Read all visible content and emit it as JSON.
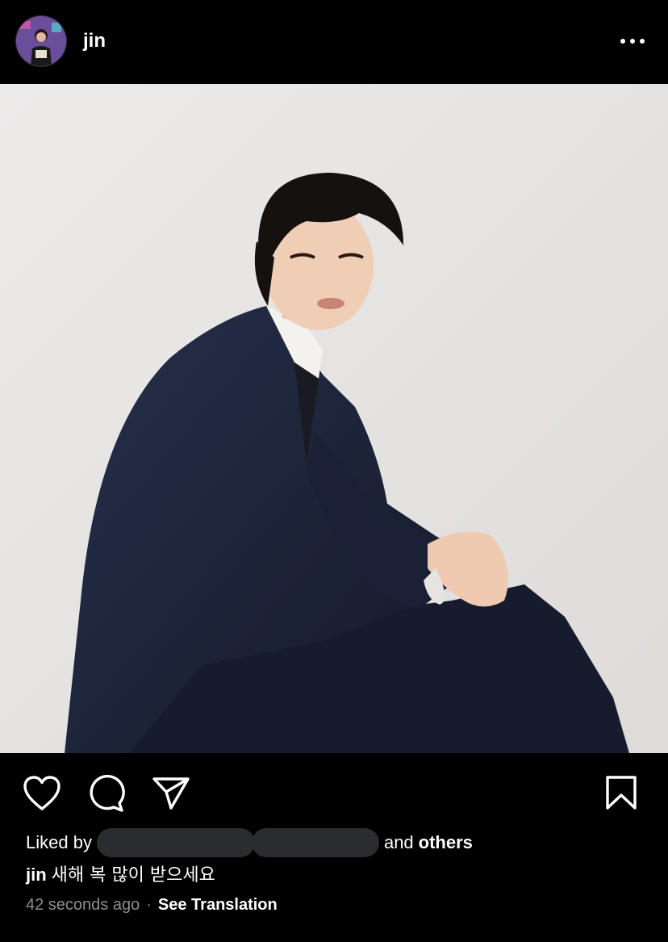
{
  "post": {
    "username": "jin",
    "more_icon": "more-horizontal-icon"
  },
  "actions": {
    "like_icon": "heart-icon",
    "comment_icon": "comment-icon",
    "share_icon": "send-icon",
    "save_icon": "bookmark-icon"
  },
  "likes": {
    "prefix": "Liked by",
    "middle": "and",
    "suffix": "others"
  },
  "caption": {
    "username": "jin",
    "text": "새해 복 많이 받으세요"
  },
  "meta": {
    "timestamp": "42 seconds ago",
    "separator": "·",
    "translate_label": "See Translation"
  },
  "colors": {
    "background": "#000000",
    "text": "#ffffff",
    "muted": "#8e8e8e",
    "redaction": "#2b2c2f",
    "photo_background": "#e9e7e6",
    "suit": "#1c2236"
  }
}
